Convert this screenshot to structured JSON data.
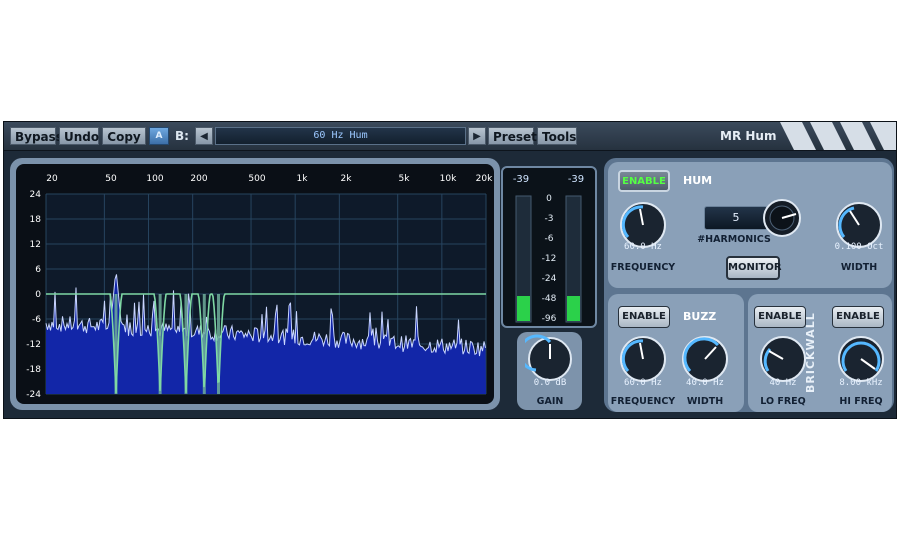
{
  "toolbar": {
    "bypass": "Bypass",
    "undo": "Undo",
    "copy": "Copy",
    "ab_toggle": "A",
    "b_label": "B:",
    "prev_icon": "triangle-left",
    "next_icon": "triangle-right",
    "preset_name": "60 Hz Hum",
    "preset": "Preset",
    "tools": "Tools",
    "plugin_name": "MR Hum"
  },
  "analyzer": {
    "freq_ticks": [
      "20",
      "50",
      "100",
      "200",
      "500",
      "1k",
      "2k",
      "5k",
      "10k",
      "20k"
    ],
    "db_ticks": [
      "24",
      "18",
      "12",
      "6",
      "0",
      "-6",
      "-12",
      "-18",
      "-24"
    ],
    "colors": {
      "spectrum": "#1226a8",
      "spectrum_line": "#c9d6ff",
      "eq_curve": "#7fd8a4",
      "grid": "#27445f"
    }
  },
  "meter": {
    "peak_left": "-39",
    "peak_right": "-39",
    "scale": [
      "0",
      "-3",
      "-6",
      "-12",
      "-24",
      "-48",
      "-96"
    ],
    "level_left_db": -48,
    "level_right_db": -48
  },
  "gain": {
    "value": "0.0 dB",
    "label": "GAIN"
  },
  "hum": {
    "enable": "ENABLE",
    "title": "HUM",
    "frequency_value": "60.0 Hz",
    "frequency_label": "FREQUENCY",
    "harmonics_value": "5",
    "harmonics_label": "#HARMONICS",
    "monitor": "MONITOR",
    "width_value": "0.100 Oct",
    "width_label": "WIDTH"
  },
  "buzz": {
    "enable": "ENABLE",
    "title": "BUZZ",
    "frequency_value": "60.0 Hz",
    "frequency_label": "FREQUENCY",
    "width_value": "40.0 Hz",
    "width_label": "WIDTH"
  },
  "brickwall": {
    "title": "BRICKWALL",
    "lo_enable": "ENABLE",
    "hi_enable": "ENABLE",
    "lo_value": "40 Hz",
    "lo_label": "LO FREQ",
    "hi_value": "8.00 kHz",
    "hi_label": "HI FREQ"
  }
}
